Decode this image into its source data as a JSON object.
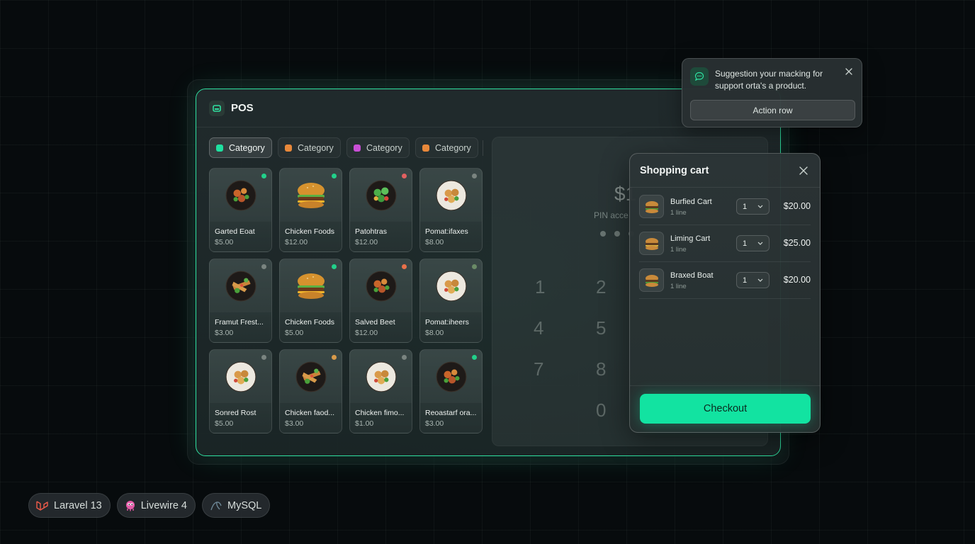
{
  "app": {
    "title": "POS"
  },
  "colors": {
    "accent": "#12e3a1",
    "frame": "#2fe0a0"
  },
  "categories": [
    {
      "label": "Category",
      "color": "#1fe0a0",
      "active": true
    },
    {
      "label": "Category",
      "color": "#e8883a",
      "active": false
    },
    {
      "label": "Category",
      "color": "#c94fd6",
      "active": false
    },
    {
      "label": "Category",
      "color": "#e8883a",
      "active": false
    }
  ],
  "products": [
    {
      "name": "Garted Eoat",
      "price": "$5.00",
      "status": "#22d08a",
      "dish": "bowl-dark"
    },
    {
      "name": "Chicken Foods",
      "price": "$12.00",
      "status": "#22d08a",
      "dish": "burger"
    },
    {
      "name": "Patohtras",
      "price": "$12.00",
      "status": "#e06060",
      "dish": "bowl-green"
    },
    {
      "name": "Pomat:ifaxes",
      "price": "$8.00",
      "status": "#7a8480",
      "dish": "bowl-white"
    },
    {
      "name": "Framut Frest...",
      "price": "$3.00",
      "status": "#7a8480",
      "dish": "bowl-salad"
    },
    {
      "name": "Chicken Foods",
      "price": "$5.00",
      "status": "#22d08a",
      "dish": "burger"
    },
    {
      "name": "Salved Beet",
      "price": "$12.00",
      "status": "#e8704a",
      "dish": "bowl-dark"
    },
    {
      "name": "Pomat:iheers",
      "price": "$8.00",
      "status": "#6a8a66",
      "dish": "bowl-white"
    },
    {
      "name": "Sonred Rost",
      "price": "$5.00",
      "status": "#7a8480",
      "dish": "bowl-white"
    },
    {
      "name": "Chicken faod...",
      "price": "$3.00",
      "status": "#d89a4a",
      "dish": "bowl-salad"
    },
    {
      "name": "Chicken fimo...",
      "price": "$1.00",
      "status": "#7a8480",
      "dish": "bowl-white"
    },
    {
      "name": "Reoastarf ora...",
      "price": "$3.00",
      "status": "#22d08a",
      "dish": "bowl-dark"
    }
  ],
  "keypad": {
    "amount": "$1",
    "pin_label": "PIN acce",
    "keys": [
      "1",
      "2",
      "4",
      "5",
      "7",
      "8",
      "0"
    ]
  },
  "cart": {
    "title": "Shopping cart",
    "items": [
      {
        "name": "Burfied Cart",
        "sub": "1 line",
        "qty": "1",
        "price": "$20.00"
      },
      {
        "name": "Liming Cart",
        "sub": "1 line",
        "qty": "1",
        "price": "$25.00"
      },
      {
        "name": "Braxed Boat",
        "sub": "1 line",
        "qty": "1",
        "price": "$20.00"
      }
    ],
    "checkout_label": "Checkout"
  },
  "toast": {
    "message": "Suggestion your macking for support orta's a product.",
    "action_label": "Action row"
  },
  "badges": [
    {
      "label": "Laravel 13",
      "icon": "laravel-icon"
    },
    {
      "label": "Livewire 4",
      "icon": "livewire-icon"
    },
    {
      "label": "MySQL",
      "icon": "mysql-icon"
    }
  ]
}
